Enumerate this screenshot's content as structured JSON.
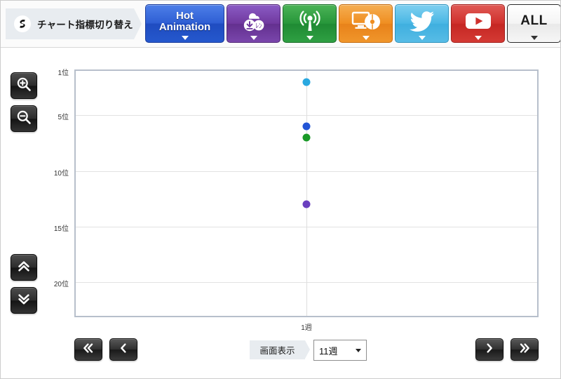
{
  "toolbar": {
    "metric_switch_label": "チャート指標切り替え",
    "metric_switch_icon": "swirl-icon",
    "tabs": [
      {
        "id": "hot-animation",
        "label": "Hot\nAnimation",
        "line1": "Hot",
        "line2": "Animation",
        "icon": "",
        "color": "#2f5fd4"
      },
      {
        "id": "download",
        "label": "",
        "icon": "cloud-download-icon",
        "color": "#70399f"
      },
      {
        "id": "broadcast",
        "label": "",
        "icon": "broadcast-tower-icon",
        "color": "#27963a"
      },
      {
        "id": "package-media",
        "label": "",
        "icon": "monitor-disc-icon",
        "color": "#ef8e21"
      },
      {
        "id": "twitter",
        "label": "",
        "icon": "twitter-bird-icon",
        "color": "#49b6e4"
      },
      {
        "id": "youtube",
        "label": "",
        "icon": "youtube-play-icon",
        "color": "#cf302c"
      },
      {
        "id": "all",
        "label": "ALL",
        "icon": "",
        "color": "#f4f4f4"
      }
    ]
  },
  "side_controls": {
    "zoom_in": "zoom-in-icon",
    "zoom_out": "zoom-out-icon",
    "scroll_up": "double-chevron-up-icon",
    "scroll_down": "double-chevron-down-icon"
  },
  "bottom_controls": {
    "first_page": "double-chevron-left-icon",
    "prev_page": "chevron-left-icon",
    "next_page": "chevron-right-icon",
    "last_page": "double-chevron-right-icon",
    "display_label": "画面表示",
    "week_selected": "11週",
    "week_options": [
      "11週"
    ]
  },
  "chart_data": {
    "type": "scatter",
    "title": "",
    "xlabel": "",
    "ylabel": "",
    "grid": true,
    "legend": "none",
    "x": [
      "1週"
    ],
    "xtick_labels": [
      "1週"
    ],
    "ytick_labels": [
      "1位",
      "5位",
      "10位",
      "15位",
      "20位"
    ],
    "ytick_values": [
      1,
      5,
      10,
      15,
      20
    ],
    "y_axis_inverted": true,
    "ylim": [
      1,
      23
    ],
    "series": [
      {
        "name": "series-cyan",
        "color": "#29a8e0",
        "points": [
          {
            "x": "1週",
            "y": 2
          }
        ]
      },
      {
        "name": "series-blue",
        "color": "#2255d6",
        "points": [
          {
            "x": "1週",
            "y": 6
          }
        ]
      },
      {
        "name": "series-green",
        "color": "#1a9a28",
        "points": [
          {
            "x": "1週",
            "y": 7
          }
        ]
      },
      {
        "name": "series-purple",
        "color": "#6a3fbf",
        "points": [
          {
            "x": "1週",
            "y": 13
          }
        ]
      }
    ]
  }
}
